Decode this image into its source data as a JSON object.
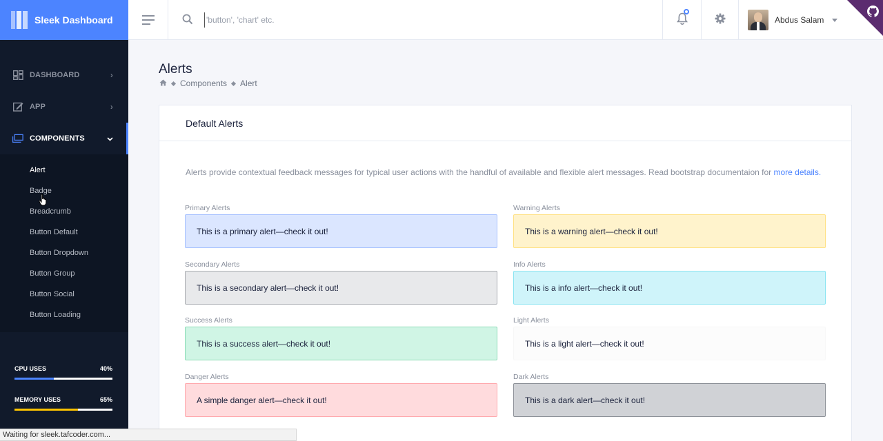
{
  "brand": {
    "name": "Sleek Dashboard"
  },
  "search": {
    "placeholder": "'button', 'chart' etc."
  },
  "user": {
    "name": "Abdus Salam"
  },
  "sidebar": {
    "items": [
      {
        "label": "DASHBOARD",
        "icon": "grid-icon",
        "chevron": "›"
      },
      {
        "label": "APP",
        "icon": "pencil-square-icon",
        "chevron": "›"
      },
      {
        "label": "COMPONENTS",
        "icon": "layers-icon",
        "chevron": "⌄"
      }
    ],
    "subitems": [
      "Alert",
      "Badge",
      "Breadcrumb",
      "Button Default",
      "Button Dropdown",
      "Button Group",
      "Button Social",
      "Button Loading"
    ],
    "usage": [
      {
        "label": "CPU USES",
        "value": "40%",
        "fraction": 0.4,
        "color": "#4c84ff"
      },
      {
        "label": "MEMORY USES",
        "value": "65%",
        "fraction": 0.65,
        "color": "#fec400"
      }
    ]
  },
  "page": {
    "title": "Alerts",
    "breadcrumb": [
      "Components",
      "Alert"
    ]
  },
  "card": {
    "title": "Default Alerts",
    "description": "Alerts provide contextual feedback messages for typical user actions with the handful of available and flexible alert messages. Read bootstrap documentaion for ",
    "link": "more details."
  },
  "alerts": [
    {
      "label": "Primary Alerts",
      "text": "This is a primary alert—check it out!",
      "bg": "#dbe6ff",
      "border": "#a6c1ff"
    },
    {
      "label": "Warning Alerts",
      "text": "This is a warning alert—check it out!",
      "bg": "#fff3cc",
      "border": "#ffe184"
    },
    {
      "label": "Secondary Alerts",
      "text": "This is a secondary alert—check it out!",
      "bg": "#e8e9eb",
      "border": "#a9acb1"
    },
    {
      "label": "Info Alerts",
      "text": "This is a info alert—check it out!",
      "bg": "#cff4fa",
      "border": "#8ae4f1"
    },
    {
      "label": "Success Alerts",
      "text": "This is a success alert—check it out!",
      "bg": "#d0f5e5",
      "border": "#8cdcb6"
    },
    {
      "label": "Light Alerts",
      "text": "This is a light alert—check it out!",
      "bg": "#fcfcfc",
      "border": "#f7f7f7"
    },
    {
      "label": "Danger Alerts",
      "text": "A simple danger alert—check it out!",
      "bg": "#ffdbdd",
      "border": "#ffaaae"
    },
    {
      "label": "Dark Alerts",
      "text": "This is a dark alert—check it out!",
      "bg": "#d0d2d6",
      "border": "#8e9299"
    }
  ],
  "statusbar": {
    "text": "Waiting for sleek.tafcoder.com..."
  }
}
